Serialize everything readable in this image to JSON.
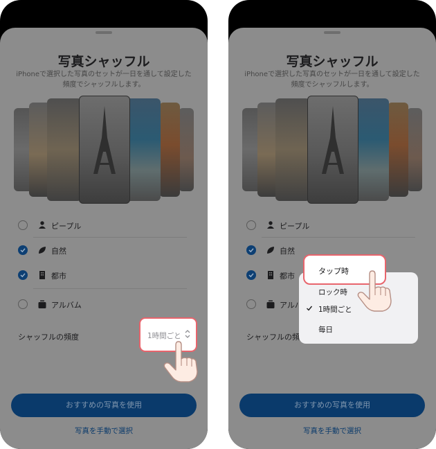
{
  "sheet": {
    "title": "写真シャッフル",
    "subtitle": "iPhoneで選択した写真のセットが一日を通して設定した頻度でシャッフルします。"
  },
  "options": [
    {
      "label": "ピープル",
      "checked": false,
      "icon": "person-icon"
    },
    {
      "label": "自然",
      "checked": true,
      "icon": "leaf-icon"
    },
    {
      "label": "都市",
      "checked": true,
      "icon": "building-icon"
    },
    {
      "label": "アルバム",
      "checked": false,
      "icon": "album-stack-icon"
    }
  ],
  "frequency": {
    "label": "シャッフルの頻度",
    "value": "1時間ごと"
  },
  "menu": {
    "items": [
      "タップ時",
      "ロック時",
      "1時間ごと",
      "毎日"
    ],
    "selected": "1時間ごと",
    "highlighted": "タップ時"
  },
  "buttons": {
    "primary": "おすすめの写真を使用",
    "secondary": "写真を手動で選択"
  },
  "colors": {
    "accent_blue": "#0a3a6b",
    "highlight_border": "#e8646c",
    "dim_overlay": "#8c8c8c"
  }
}
